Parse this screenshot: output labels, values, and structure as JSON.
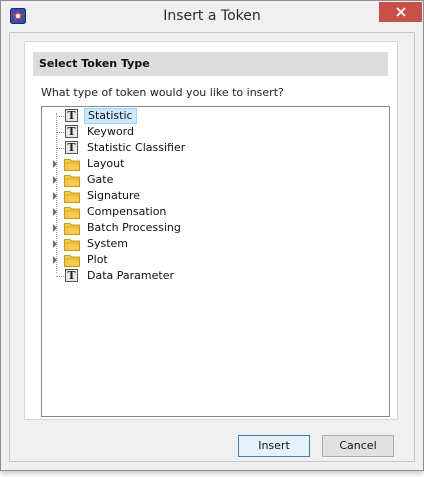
{
  "window": {
    "title": "Insert a Token",
    "app_icon": "flowjo-app-icon",
    "close_icon": "close-icon"
  },
  "group": {
    "header": "Select Token Type",
    "question": "What type of token would you like to insert?"
  },
  "tree": {
    "items": [
      {
        "label": "Statistic",
        "type": "token",
        "expandable": false,
        "selected": true
      },
      {
        "label": "Keyword",
        "type": "token",
        "expandable": false,
        "selected": false
      },
      {
        "label": "Statistic Classifier",
        "type": "token",
        "expandable": false,
        "selected": false
      },
      {
        "label": "Layout",
        "type": "folder",
        "expandable": true,
        "selected": false
      },
      {
        "label": "Gate",
        "type": "folder",
        "expandable": true,
        "selected": false
      },
      {
        "label": "Signature",
        "type": "folder",
        "expandable": true,
        "selected": false
      },
      {
        "label": "Compensation",
        "type": "folder",
        "expandable": true,
        "selected": false
      },
      {
        "label": "Batch Processing",
        "type": "folder",
        "expandable": true,
        "selected": false
      },
      {
        "label": "System",
        "type": "folder",
        "expandable": true,
        "selected": false
      },
      {
        "label": "Plot",
        "type": "folder",
        "expandable": true,
        "selected": false
      },
      {
        "label": "Data Parameter",
        "type": "token",
        "expandable": false,
        "selected": false
      }
    ]
  },
  "buttons": {
    "insert": "Insert",
    "cancel": "Cancel"
  },
  "colors": {
    "selection_bg": "#cde8ff",
    "close_button": "#c7504b",
    "default_button_border": "#3c7fb1"
  }
}
